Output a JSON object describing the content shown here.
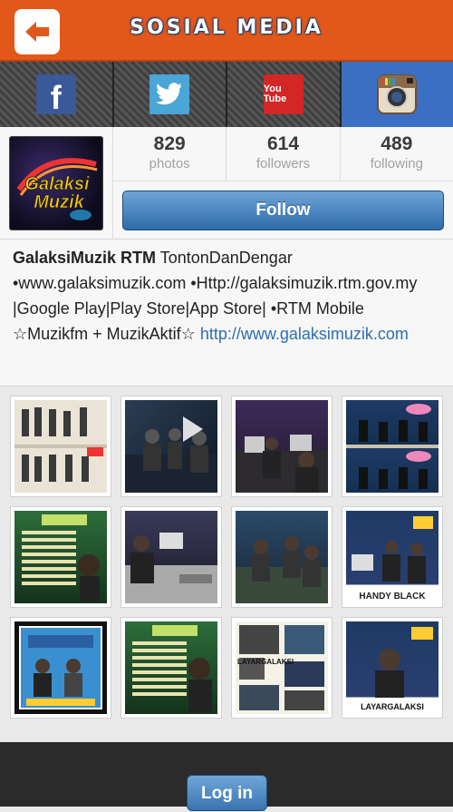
{
  "header": {
    "title": "SOSIAL MEDIA",
    "back_icon": "back-arrow-icon"
  },
  "tabs": [
    {
      "name": "facebook",
      "icon": "facebook-icon",
      "glyph": "f",
      "color": "#3b5998",
      "active": false
    },
    {
      "name": "twitter",
      "icon": "twitter-icon",
      "color": "#4aa6d6",
      "active": false
    },
    {
      "name": "youtube",
      "icon": "youtube-icon",
      "glyph": "You Tube",
      "color": "#d32626",
      "active": false
    },
    {
      "name": "instagram",
      "icon": "instagram-icon",
      "color": "#8a6a4a",
      "active": true
    }
  ],
  "profile": {
    "avatar_text": "Galaksi Muzik",
    "stats": [
      {
        "value": "829",
        "label": "photos"
      },
      {
        "value": "614",
        "label": "followers"
      },
      {
        "value": "489",
        "label": "following"
      }
    ],
    "follow_label": "Follow"
  },
  "bio": {
    "username": "GalaksiMuzik RTM",
    "text": " TontonDanDengar •www.galaksimuzik.com •Http://galaksimuzik.rtm.gov.my |Google Play|Play Store|App Store| •RTM Mobile ☆Muzikfm + MuzikAktif☆ ",
    "link": "http://www.galaksimuzik.com"
  },
  "photos": [
    {
      "label": ""
    },
    {
      "label": ""
    },
    {
      "label": ""
    },
    {
      "label": ""
    },
    {
      "label": ""
    },
    {
      "label": ""
    },
    {
      "label": ""
    },
    {
      "label": "HANDY BLACK"
    },
    {
      "label": ""
    },
    {
      "label": ""
    },
    {
      "label": "LAYARGALAKSI"
    },
    {
      "label": "LAYARGALAKSI"
    }
  ],
  "footer": {
    "login_label": "Log in"
  },
  "colors": {
    "header": "#e2581b",
    "button": "#2e6aa8",
    "active_tab": "#3a6fc3"
  }
}
